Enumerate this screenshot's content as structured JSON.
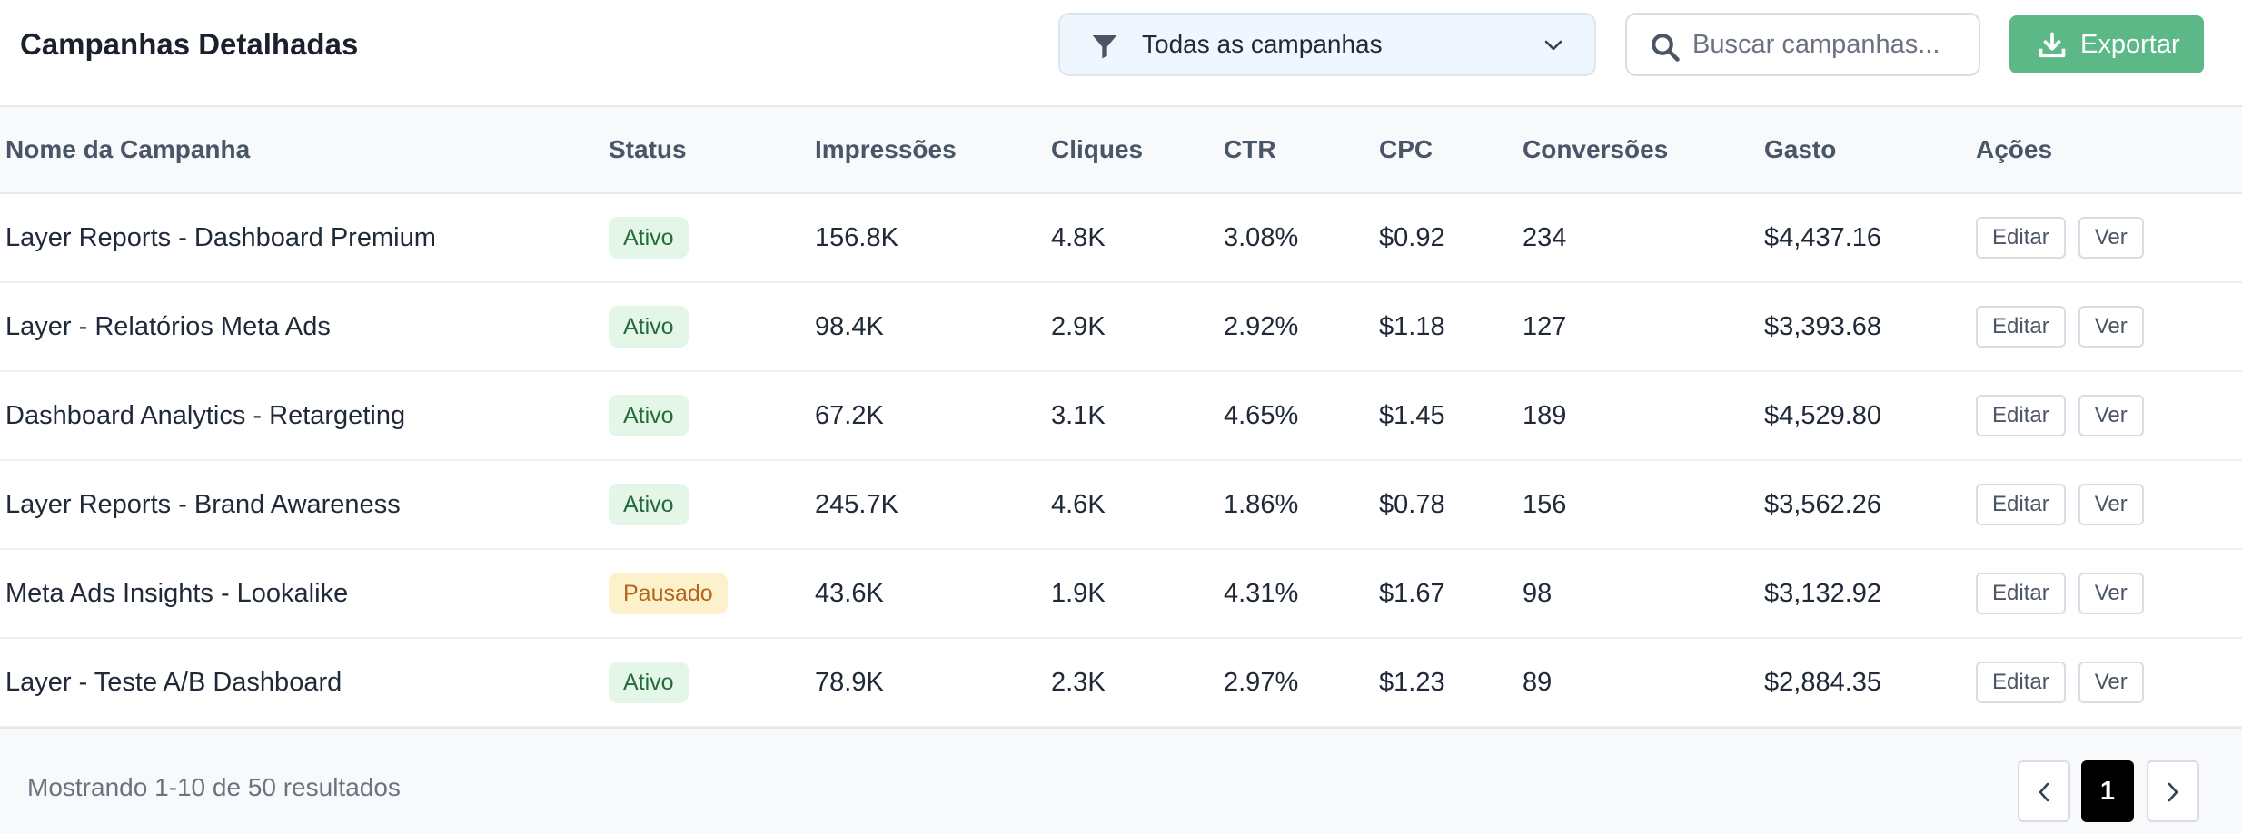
{
  "header": {
    "title": "Campanhas Detalhadas",
    "filter": {
      "selected": "Todas as campanhas",
      "icon": "filter-icon"
    },
    "search": {
      "placeholder": "Buscar campanhas...",
      "value": "",
      "icon": "search-icon"
    },
    "export": {
      "label": "Exportar",
      "icon": "download-icon",
      "color": "#5cb987"
    }
  },
  "table": {
    "columns": [
      "Nome da Campanha",
      "Status",
      "Impressões",
      "Cliques",
      "CTR",
      "CPC",
      "Conversões",
      "Gasto",
      "Ações"
    ],
    "rows": [
      {
        "name": "Layer Reports - Dashboard Premium",
        "status": "Ativo",
        "impressions": "156.8K",
        "clicks": "4.8K",
        "ctr": "3.08%",
        "cpc": "$0.92",
        "conversions": "234",
        "spend": "$4,437.16"
      },
      {
        "name": "Layer - Relatórios Meta Ads",
        "status": "Ativo",
        "impressions": "98.4K",
        "clicks": "2.9K",
        "ctr": "2.92%",
        "cpc": "$1.18",
        "conversions": "127",
        "spend": "$3,393.68"
      },
      {
        "name": "Dashboard Analytics - Retargeting",
        "status": "Ativo",
        "impressions": "67.2K",
        "clicks": "3.1K",
        "ctr": "4.65%",
        "cpc": "$1.45",
        "conversions": "189",
        "spend": "$4,529.80"
      },
      {
        "name": "Layer Reports - Brand Awareness",
        "status": "Ativo",
        "impressions": "245.7K",
        "clicks": "4.6K",
        "ctr": "1.86%",
        "cpc": "$0.78",
        "conversions": "156",
        "spend": "$3,562.26"
      },
      {
        "name": "Meta Ads Insights - Lookalike",
        "status": "Pausado",
        "impressions": "43.6K",
        "clicks": "1.9K",
        "ctr": "4.31%",
        "cpc": "$1.67",
        "conversions": "98",
        "spend": "$3,132.92"
      },
      {
        "name": "Layer - Teste A/B Dashboard",
        "status": "Ativo",
        "impressions": "78.9K",
        "clicks": "2.3K",
        "ctr": "2.97%",
        "cpc": "$1.23",
        "conversions": "89",
        "spend": "$2,884.35"
      }
    ],
    "actions": {
      "edit": "Editar",
      "view": "Ver"
    },
    "status_colors": {
      "Ativo": "#e3f6e8",
      "Pausado": "#fdf1cc"
    }
  },
  "footer": {
    "summary": "Mostrando 1-10 de 50 resultados",
    "current_page": "1",
    "prev_icon": "chevron-left-icon",
    "next_icon": "chevron-right-icon"
  }
}
